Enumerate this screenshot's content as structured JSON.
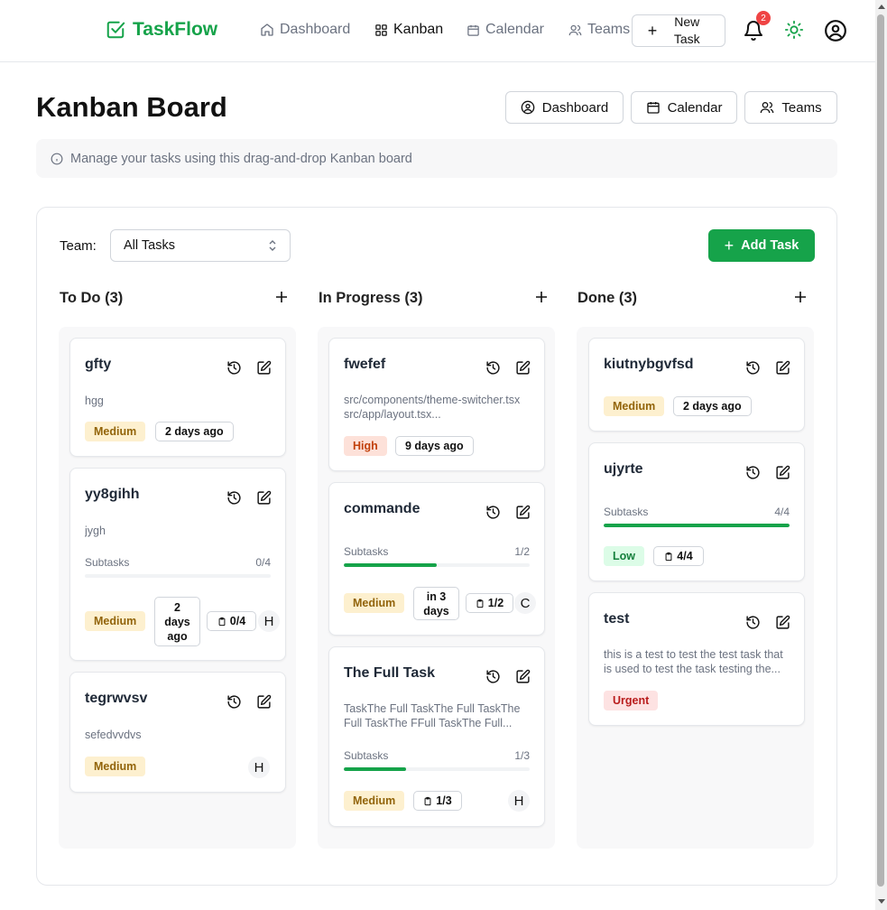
{
  "nav": {
    "brand": "TaskFlow",
    "links": [
      "Dashboard",
      "Kanban",
      "Calendar",
      "Teams"
    ],
    "active": "Kanban",
    "new_task": "New Task",
    "notifications": "2"
  },
  "header": {
    "title": "Kanban Board",
    "buttons": [
      "Dashboard",
      "Calendar",
      "Teams"
    ],
    "info": "Manage your tasks using this drag-and-drop Kanban board"
  },
  "toolbar": {
    "team_label": "Team:",
    "team_value": "All Tasks",
    "add_task": "Add Task"
  },
  "columns": [
    {
      "title": "To Do (3)",
      "cards": [
        {
          "title": "gfty",
          "desc": "hgg",
          "priority": "Medium",
          "date": "2 days ago"
        },
        {
          "title": "yy8gihh",
          "desc": "jygh",
          "subtasks_label": "Subtasks",
          "subtasks": "0/4",
          "progress": 0,
          "priority": "Medium",
          "date": "2 days ago",
          "chip": "0/4",
          "avatar": "H"
        },
        {
          "title": "tegrwvsv",
          "desc": "sefedvvdvs",
          "priority": "Medium",
          "avatar": "H"
        }
      ]
    },
    {
      "title": "In Progress (3)",
      "cards": [
        {
          "title": "fwefef",
          "desc": "src/components/theme-switcher.tsx src/app/layout.tsx...",
          "priority": "High",
          "date": "9 days ago"
        },
        {
          "title": "commande",
          "subtasks_label": "Subtasks",
          "subtasks": "1/2",
          "progress": 0.5,
          "priority": "Medium",
          "date": "in 3 days",
          "chip": "1/2",
          "avatar": "C"
        },
        {
          "title": "The Full Task",
          "desc": "TaskThe Full TaskThe Full TaskThe Full TaskThe FFull TaskThe Full...",
          "subtasks_label": "Subtasks",
          "subtasks": "1/3",
          "progress": 0.333,
          "priority": "Medium",
          "chip": "1/3",
          "avatar": "H"
        }
      ]
    },
    {
      "title": "Done (3)",
      "cards": [
        {
          "title": "kiutnybgvfsd",
          "priority": "Medium",
          "date": "2 days ago"
        },
        {
          "title": "ujyrte",
          "subtasks_label": "Subtasks",
          "subtasks": "4/4",
          "progress": 1,
          "priority": "Low",
          "chip": "4/4"
        },
        {
          "title": "test",
          "desc": "this is a test to test the test task that is used to test the task testing the...",
          "priority": "Urgent"
        }
      ]
    }
  ],
  "colors": {
    "brand": "#16a34a",
    "badge": "#ef4444"
  }
}
